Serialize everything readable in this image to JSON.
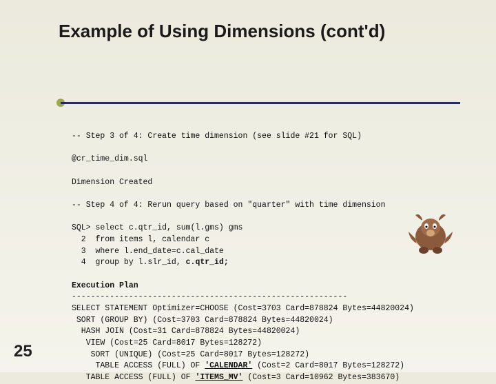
{
  "title": "Example of Using Dimensions (cont'd)",
  "page_number": "25",
  "lines": {
    "l1": "-- Step 3 of 4: Create time dimension (see slide #21 for SQL)",
    "l2": "@cr_time_dim.sql",
    "l3": "Dimension Created",
    "l4": "-- Step 4 of 4: Rerun query based on \"quarter\" with time dimension",
    "l5a": "SQL> select c.qtr_id, sum(l.gms) gms",
    "l5b": "  2  from items l, calendar c",
    "l5c": "  3  where l.end_date=c.cal_date",
    "l5d_pre": "  4  group by l.slr_id, ",
    "l5d_bold": "c.qtr_id;",
    "l6": "Execution Plan",
    "l7": "----------------------------------------------------------",
    "l8": "SELECT STATEMENT Optimizer=CHOOSE (Cost=3703 Card=878824 Bytes=44820024)",
    "l9": " SORT (GROUP BY) (Cost=3703 Card=878824 Bytes=44820024)",
    "l10": "  HASH JOIN (Cost=31 Card=878824 Bytes=44820024)",
    "l11": "   VIEW (Cost=25 Card=8017 Bytes=128272)",
    "l12": "    SORT (UNIQUE) (Cost=25 Card=8017 Bytes=128272)",
    "l13_pre": "     TABLE ACCESS (FULL) OF ",
    "l13_bold": "'CALENDAR'",
    "l13_post": " (Cost=2 Card=8017 Bytes=128272)",
    "l14_pre": "   TABLE ACCESS (FULL) OF ",
    "l14_bold": "'ITEMS_MV'",
    "l14_post": " (Cost=3 Card=10962 Bytes=383670)"
  }
}
